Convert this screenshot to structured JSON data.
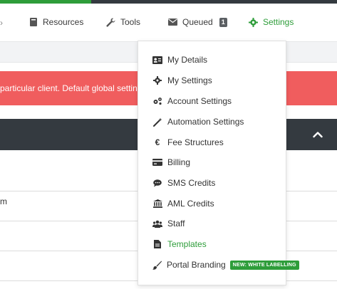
{
  "colors": {
    "accent": "#2e9d3a",
    "alert": "#f05d5e",
    "dark": "#343a40"
  },
  "nav": {
    "resources": {
      "label": "Resources",
      "icon": "book-icon"
    },
    "tools": {
      "label": "Tools",
      "icon": "wrench-icon"
    },
    "queued": {
      "label": "Queued",
      "icon": "envelope-icon",
      "count": "1"
    },
    "settings": {
      "label": "Settings",
      "icon": "gear-icon"
    }
  },
  "alert": {
    "text": "particular client. Default global settings"
  },
  "table": {
    "row_text": "m"
  },
  "settings_menu": {
    "items": [
      {
        "label": "My Details",
        "icon": "id-card-icon"
      },
      {
        "label": "My Settings",
        "icon": "gear-icon"
      },
      {
        "label": "Account Settings",
        "icon": "gears-icon"
      },
      {
        "label": "Automation Settings",
        "icon": "magic-wand-icon"
      },
      {
        "label": "Fee Structures",
        "icon": "euro-icon"
      },
      {
        "label": "Billing",
        "icon": "credit-card-icon"
      },
      {
        "label": "SMS Credits",
        "icon": "speech-bubble-icon"
      },
      {
        "label": "AML Credits",
        "icon": "bank-icon"
      },
      {
        "label": "Staff",
        "icon": "users-icon"
      },
      {
        "label": "Templates",
        "icon": "file-icon",
        "active": true
      },
      {
        "label": "Portal Branding",
        "icon": "paint-brush-icon",
        "badge": "NEW: WHITE LABELLING"
      }
    ]
  }
}
